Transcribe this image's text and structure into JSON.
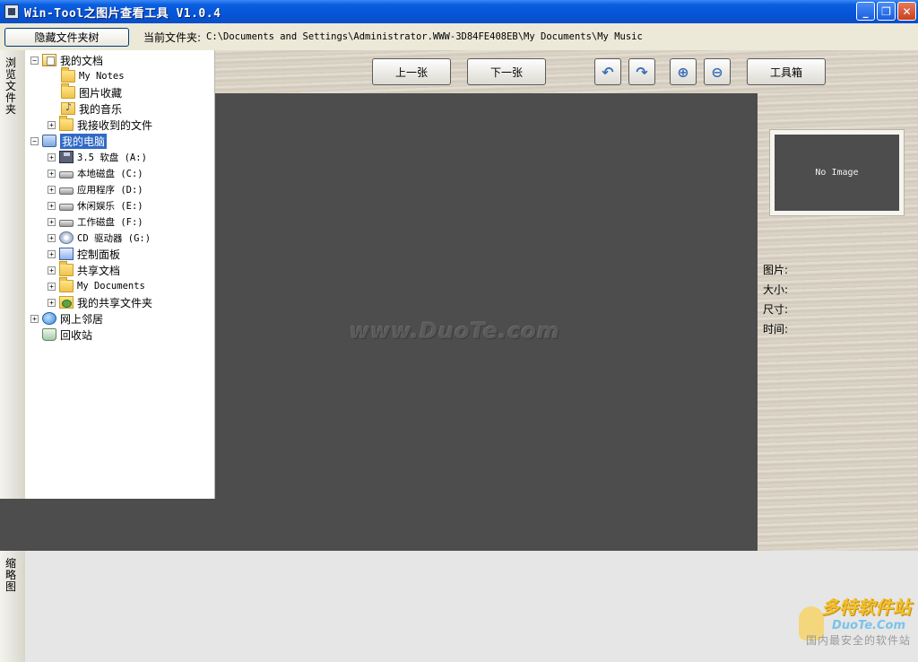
{
  "window": {
    "title": "Win-Tool之图片查看工具 V1.0.4",
    "minimize": "_",
    "restore": "❐",
    "close": "✕"
  },
  "topbar": {
    "hide_folder_label": "隐藏文件夹树",
    "current_folder_label": "当前文件夹:",
    "current_folder_path": "C:\\Documents and Settings\\Administrator.WWW-3D84FE408EB\\My Documents\\My Music"
  },
  "side_tabs": {
    "browse": "浏览文件夹",
    "thumbnails": "缩略图"
  },
  "tree": {
    "my_documents": "我的文档",
    "my_notes": "My Notes",
    "picture_collection": "图片收藏",
    "my_music": "我的音乐",
    "received_files": "我接收到的文件",
    "my_computer": "我的电脑",
    "floppy": "3.5 软盘 (A:)",
    "local_disk": "本地磁盘 (C:)",
    "apps_disk": "应用程序 (D:)",
    "leisure_disk": "休闲娱乐 (E:)",
    "work_disk": "工作磁盘 (F:)",
    "cd_drive": "CD 驱动器 (G:)",
    "control_panel": "控制面板",
    "shared_docs": "共享文档",
    "my_documents_2": "My Documents",
    "my_shared_folder": "我的共享文件夹",
    "network": "网上邻居",
    "recycle_bin": "回收站"
  },
  "toolbar": {
    "prev": "上一张",
    "next": "下一张",
    "rotate_left_icon": "rotate-left-icon",
    "rotate_right_icon": "rotate-right-icon",
    "zoom_in_icon": "zoom-in-icon",
    "zoom_out_icon": "zoom-out-icon",
    "toolbox": "工具箱"
  },
  "viewer": {
    "watermark": "www.DuoTe.com"
  },
  "preview": {
    "placeholder": "No Image"
  },
  "info": {
    "picture": "图片:",
    "size": "大小:",
    "dimensions": "尺寸:",
    "time": "时间:"
  },
  "branding": {
    "logo_cn": "多特软件站",
    "logo_en": "DuoTe.Com",
    "slogan": "国内最安全的软件站"
  }
}
